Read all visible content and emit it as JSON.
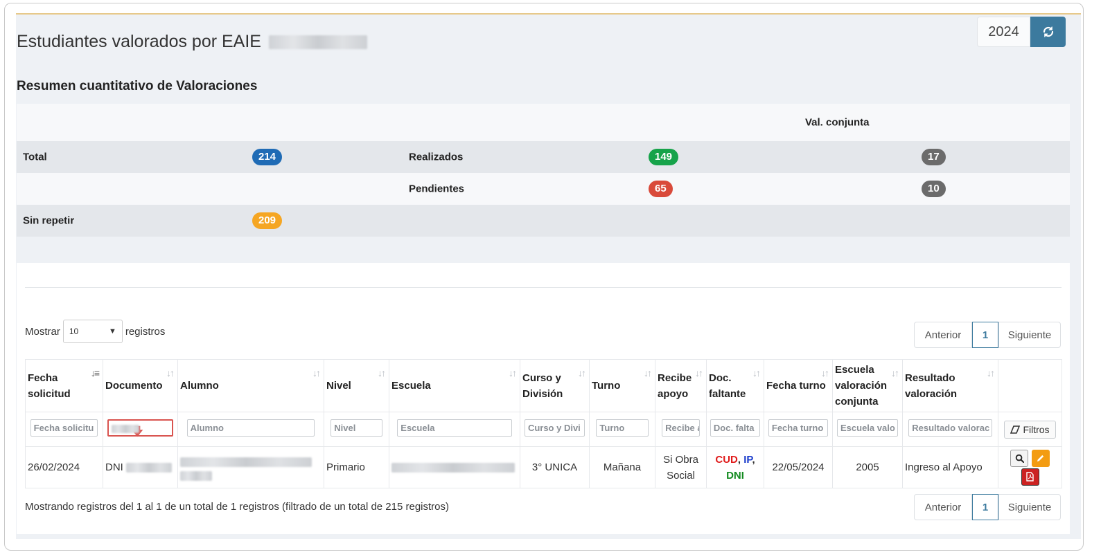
{
  "header": {
    "title": "Estudiantes valorados por EAIE",
    "year": "2024"
  },
  "summary": {
    "section_title": "Resumen cuantitativo de Valoraciones",
    "col_header": "Val. conjunta",
    "total_label": "Total",
    "total_value": "214",
    "realizados_label": "Realizados",
    "realizados_value": "149",
    "realizados_conjunta": "17",
    "pendientes_label": "Pendientes",
    "pendientes_value": "65",
    "pendientes_conjunta": "10",
    "sin_repetir_label": "Sin repetir",
    "sin_repetir_value": "209"
  },
  "table_controls": {
    "mostrar": "Mostrar",
    "page_size": "10",
    "registros": "registros",
    "prev": "Anterior",
    "page": "1",
    "next": "Siguiente"
  },
  "columns": [
    {
      "label": "Fecha solicitud",
      "placeholder": "Fecha solicitu"
    },
    {
      "label": "Documento",
      "placeholder": ""
    },
    {
      "label": "Alumno",
      "placeholder": "Alumno"
    },
    {
      "label": "Nivel",
      "placeholder": "Nivel"
    },
    {
      "label": "Escuela",
      "placeholder": "Escuela"
    },
    {
      "label": "Curso y División",
      "placeholder": "Curso y Divi"
    },
    {
      "label": "Turno",
      "placeholder": "Turno"
    },
    {
      "label": "Recibe apoyo",
      "placeholder": "Recibe a"
    },
    {
      "label": "Doc. faltante",
      "placeholder": "Doc. falta"
    },
    {
      "label": "Fecha turno",
      "placeholder": "Fecha turno"
    },
    {
      "label": "Escuela valoración conjunta",
      "placeholder": "Escuela valo"
    },
    {
      "label": "Resultado valoración",
      "placeholder": "Resultado valorac"
    }
  ],
  "filters_button": "Filtros",
  "rows": [
    {
      "fecha_solicitud": "26/02/2024",
      "documento_prefix": "DNI",
      "nivel": "Primario",
      "curso": "3° UNICA",
      "turno": "Mañana",
      "recibe_apoyo": "Si Obra Social",
      "doc_cud": "CUD",
      "doc_sep1": ",",
      "doc_ip": "IP",
      "doc_sep2": ",",
      "doc_dni": "DNI",
      "fecha_turno": "22/05/2024",
      "escuela_conjunta": "2005",
      "resultado": "Ingreso al Apoyo"
    }
  ],
  "footer_info": "Mostrando registros del 1 al 1 de un total de 1 registros (filtrado de un total de 215 registros)",
  "colors": {
    "accent": "#3c7a9e",
    "cud": "#e01b1b",
    "ip": "#1a3ccc",
    "dni": "#118a1e"
  }
}
